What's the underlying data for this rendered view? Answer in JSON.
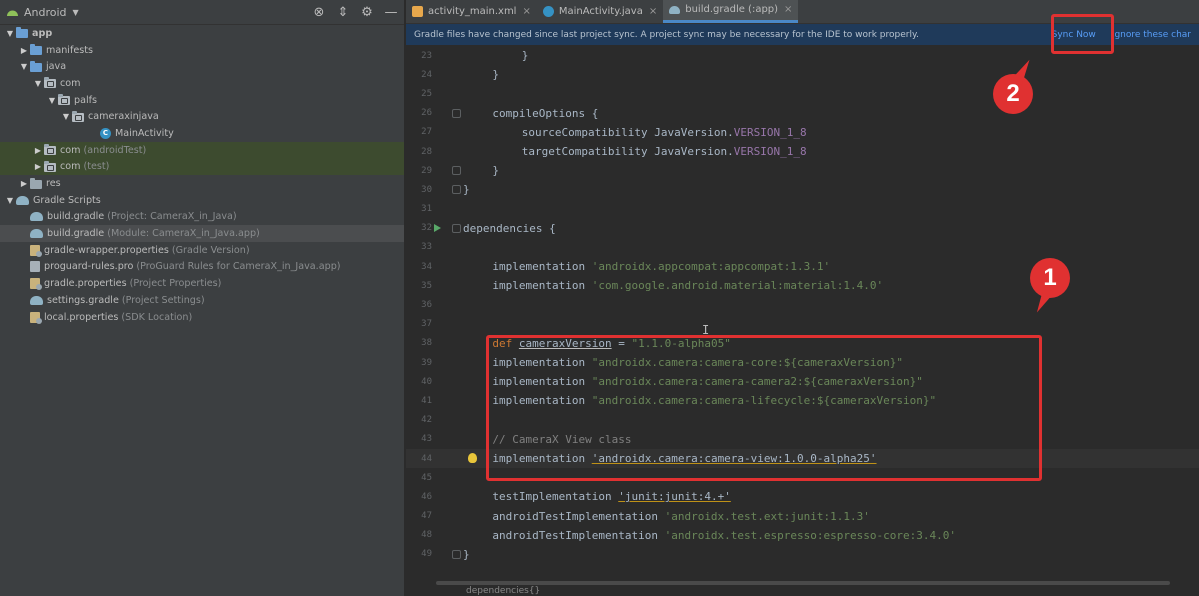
{
  "project_panel": {
    "view_label": "Android",
    "tool_icons": [
      "globe-settings-icon",
      "collapse-all-icon",
      "gear-icon",
      "minimize-icon"
    ],
    "tree": [
      {
        "label": "app",
        "hint": "",
        "depth": 0,
        "arrow": "down",
        "icon": "folder-blue",
        "bold": true,
        "highlight": ""
      },
      {
        "label": "manifests",
        "hint": "",
        "depth": 1,
        "arrow": "right",
        "icon": "folder-blue",
        "bold": false,
        "highlight": ""
      },
      {
        "label": "java",
        "hint": "",
        "depth": 1,
        "arrow": "down",
        "icon": "folder-blue",
        "bold": false,
        "highlight": ""
      },
      {
        "label": "com",
        "hint": "",
        "depth": 2,
        "arrow": "down",
        "icon": "folder-pkg",
        "bold": false,
        "highlight": ""
      },
      {
        "label": "palfs",
        "hint": "",
        "depth": 3,
        "arrow": "down",
        "icon": "folder-pkg",
        "bold": false,
        "highlight": ""
      },
      {
        "label": "cameraxinjava",
        "hint": "",
        "depth": 4,
        "arrow": "down",
        "icon": "folder-pkg",
        "bold": false,
        "highlight": ""
      },
      {
        "label": "MainActivity",
        "hint": "",
        "depth": 6,
        "arrow": "none",
        "icon": "class",
        "bold": false,
        "highlight": ""
      },
      {
        "label": "com",
        "hint": "(androidTest)",
        "depth": 2,
        "arrow": "right",
        "icon": "folder-pkg",
        "bold": false,
        "highlight": "hl"
      },
      {
        "label": "com",
        "hint": "(test)",
        "depth": 2,
        "arrow": "right",
        "icon": "folder-pkg",
        "bold": false,
        "highlight": "hl"
      },
      {
        "label": "res",
        "hint": "",
        "depth": 1,
        "arrow": "right",
        "icon": "folder",
        "bold": false,
        "highlight": ""
      },
      {
        "label": "Gradle Scripts",
        "hint": "",
        "depth": 0,
        "arrow": "down",
        "icon": "gradle",
        "bold": false,
        "highlight": ""
      },
      {
        "label": "build.gradle",
        "hint": "(Project: CameraX_in_Java)",
        "depth": 1,
        "arrow": "none",
        "icon": "gradle",
        "bold": false,
        "highlight": ""
      },
      {
        "label": "build.gradle",
        "hint": "(Module: CameraX_in_Java.app)",
        "depth": 1,
        "arrow": "none",
        "icon": "gradle",
        "bold": false,
        "highlight": "sel"
      },
      {
        "label": "gradle-wrapper.properties",
        "hint": "(Gradle Version)",
        "depth": 1,
        "arrow": "none",
        "icon": "props",
        "bold": false,
        "highlight": ""
      },
      {
        "label": "proguard-rules.pro",
        "hint": "(ProGuard Rules for CameraX_in_Java.app)",
        "depth": 1,
        "arrow": "none",
        "icon": "pro",
        "bold": false,
        "highlight": ""
      },
      {
        "label": "gradle.properties",
        "hint": "(Project Properties)",
        "depth": 1,
        "arrow": "none",
        "icon": "props",
        "bold": false,
        "highlight": ""
      },
      {
        "label": "settings.gradle",
        "hint": "(Project Settings)",
        "depth": 1,
        "arrow": "none",
        "icon": "gradle",
        "bold": false,
        "highlight": ""
      },
      {
        "label": "local.properties",
        "hint": "(SDK Location)",
        "depth": 1,
        "arrow": "none",
        "icon": "props",
        "bold": false,
        "highlight": ""
      }
    ]
  },
  "tabs": [
    {
      "label": "activity_main.xml",
      "icon": "xml",
      "active": false
    },
    {
      "label": "MainActivity.java",
      "icon": "java",
      "active": false
    },
    {
      "label": "build.gradle (:app)",
      "icon": "grd",
      "active": true
    }
  ],
  "banner": {
    "message": "Gradle files have changed since last project sync. A project sync may be necessary for the IDE to work properly.",
    "sync_now": "Sync Now",
    "ignore": "Ignore these char"
  },
  "code_lines": [
    {
      "n": "23",
      "indent": 8,
      "tokens": [
        [
          "txt",
          "}"
        ]
      ]
    },
    {
      "n": "24",
      "indent": 4,
      "tokens": [
        [
          "txt",
          "}"
        ]
      ]
    },
    {
      "n": "25",
      "indent": 0,
      "tokens": []
    },
    {
      "n": "26",
      "indent": 4,
      "fold": true,
      "tokens": [
        [
          "txt",
          "compileOptions {"
        ]
      ]
    },
    {
      "n": "27",
      "indent": 8,
      "tokens": [
        [
          "txt",
          "sourceCompatibility JavaVersion."
        ],
        [
          "cst",
          "VERSION_1_8"
        ]
      ]
    },
    {
      "n": "28",
      "indent": 8,
      "tokens": [
        [
          "txt",
          "targetCompatibility JavaVersion."
        ],
        [
          "cst",
          "VERSION_1_8"
        ]
      ]
    },
    {
      "n": "29",
      "indent": 4,
      "fold": true,
      "tokens": [
        [
          "txt",
          "}"
        ]
      ]
    },
    {
      "n": "30",
      "indent": 0,
      "fold": true,
      "tokens": [
        [
          "txt",
          "}"
        ]
      ]
    },
    {
      "n": "31",
      "indent": 0,
      "tokens": []
    },
    {
      "n": "32",
      "indent": 0,
      "run": true,
      "fold": true,
      "tokens": [
        [
          "txt",
          "dependencies {"
        ]
      ]
    },
    {
      "n": "33",
      "indent": 0,
      "tokens": []
    },
    {
      "n": "34",
      "indent": 4,
      "tokens": [
        [
          "txt",
          "implementation "
        ],
        [
          "str",
          "'androidx.appcompat:appcompat:1.3.1'"
        ]
      ]
    },
    {
      "n": "35",
      "indent": 4,
      "tokens": [
        [
          "txt",
          "implementation "
        ],
        [
          "str",
          "'com.google.android.material:material:1.4.0'"
        ]
      ]
    },
    {
      "n": "36",
      "indent": 0,
      "tokens": []
    },
    {
      "n": "37",
      "indent": 0,
      "tokens": []
    },
    {
      "n": "38",
      "indent": 4,
      "tokens": [
        [
          "kw",
          "def "
        ],
        [
          "und",
          "cameraxVersion"
        ],
        [
          "txt",
          " = "
        ],
        [
          "str",
          "\"1.1.0-alpha05\""
        ]
      ]
    },
    {
      "n": "39",
      "indent": 4,
      "tokens": [
        [
          "txt",
          "implementation "
        ],
        [
          "str",
          "\"androidx.camera:camera-core:${cameraxVersion}\""
        ]
      ]
    },
    {
      "n": "40",
      "indent": 4,
      "tokens": [
        [
          "txt",
          "implementation "
        ],
        [
          "str",
          "\"androidx.camera:camera-camera2:${cameraxVersion}\""
        ]
      ]
    },
    {
      "n": "41",
      "indent": 4,
      "tokens": [
        [
          "txt",
          "implementation "
        ],
        [
          "str",
          "\"androidx.camera:camera-lifecycle:${cameraxVersion}\""
        ]
      ]
    },
    {
      "n": "42",
      "indent": 0,
      "tokens": []
    },
    {
      "n": "43",
      "indent": 4,
      "tokens": [
        [
          "cmt",
          "// CameraX View class"
        ]
      ]
    },
    {
      "n": "44",
      "indent": 4,
      "bulb": true,
      "current": true,
      "tokens": [
        [
          "txt",
          "implementation "
        ],
        [
          "warn",
          "'androidx.camera:camera-view:1.0.0-alpha25'"
        ]
      ]
    },
    {
      "n": "45",
      "indent": 0,
      "tokens": []
    },
    {
      "n": "46",
      "indent": 4,
      "tokens": [
        [
          "txt",
          "testImplementation "
        ],
        [
          "warn",
          "'junit:junit:4.+'"
        ]
      ]
    },
    {
      "n": "47",
      "indent": 4,
      "tokens": [
        [
          "txt",
          "androidTestImplementation "
        ],
        [
          "str",
          "'androidx.test.ext:junit:1.1.3'"
        ]
      ]
    },
    {
      "n": "48",
      "indent": 4,
      "tokens": [
        [
          "txt",
          "androidTestImplementation "
        ],
        [
          "str",
          "'androidx.test.espresso:espresso-core:3.4.0'"
        ]
      ]
    },
    {
      "n": "49",
      "indent": 0,
      "fold": true,
      "tokens": [
        [
          "txt",
          "}"
        ]
      ]
    }
  ],
  "breadcrumb": "dependencies{}",
  "annotations": {
    "badge1": "1",
    "badge2": "2"
  }
}
